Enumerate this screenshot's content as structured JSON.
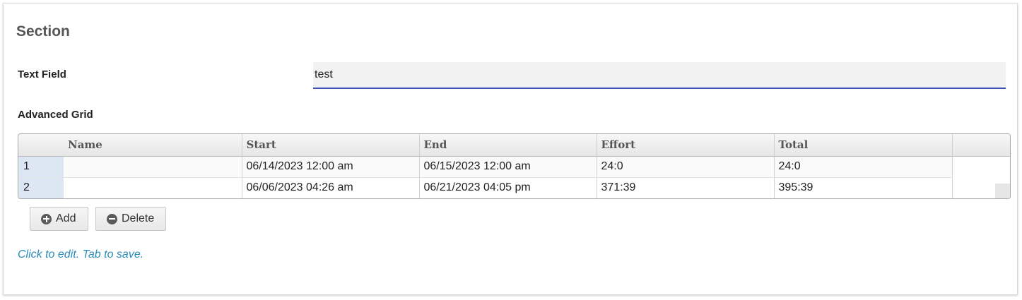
{
  "section": {
    "title": "Section"
  },
  "text_field": {
    "label": "Text Field",
    "value": "test"
  },
  "grid": {
    "label": "Advanced Grid",
    "columns": [
      "Name",
      "Start",
      "End",
      "Effort",
      "Total"
    ],
    "rows": [
      {
        "num": "1",
        "name": "",
        "start": "06/14/2023 12:00 am",
        "end": "06/15/2023 12:00 am",
        "effort": "24:0",
        "total": "24:0"
      },
      {
        "num": "2",
        "name": "",
        "start": "06/06/2023 04:26 am",
        "end": "06/21/2023 04:05 pm",
        "effort": "371:39",
        "total": "395:39"
      }
    ]
  },
  "buttons": {
    "add": "Add",
    "delete": "Delete",
    "add_icon": "plus-circle-icon",
    "delete_icon": "minus-circle-icon"
  },
  "hint": "Click to edit. Tab to save.",
  "colors": {
    "input_underline": "#3f51b5",
    "hint": "#2a8ab8",
    "rownum_bg": "#dde6f3"
  }
}
